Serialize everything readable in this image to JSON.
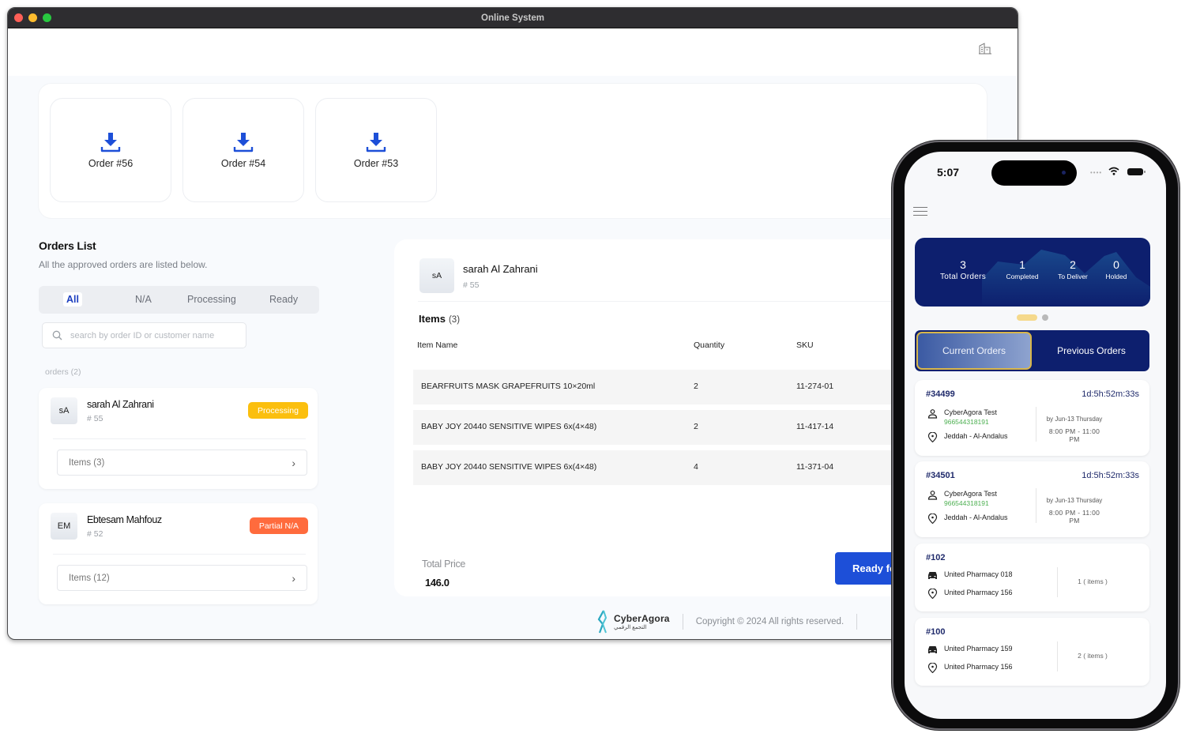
{
  "window": {
    "title": "Online System"
  },
  "downloads": [
    {
      "label": "Order #56",
      "icon": "download-icon"
    },
    {
      "label": "Order #54",
      "icon": "download-icon"
    },
    {
      "label": "Order #53",
      "icon": "download-icon"
    }
  ],
  "orders_list": {
    "title": "Orders List",
    "subtitle": "All the approved orders are listed below.",
    "tabs": [
      "All",
      "N/A",
      "Processing",
      "Ready"
    ],
    "active_tab": "All",
    "search_placeholder": "search by order ID or customer name",
    "count_label": "orders (2)",
    "orders": [
      {
        "initials": "sA",
        "name": "sarah Al Zahrani",
        "id": "# 55",
        "status": "Processing",
        "status_color": "#fbbf0e",
        "items_label": "Items  (3)"
      },
      {
        "initials": "EM",
        "name": "Ebtesam Mahfouz",
        "id": "# 52",
        "status": "Partial N/A",
        "status_color": "#ff6b3d",
        "items_label": "Items  (12)"
      }
    ]
  },
  "detail": {
    "initials": "sA",
    "name": "sarah Al Zahrani",
    "id": "# 55",
    "items_title": "Items",
    "items_count": "(3)",
    "columns": [
      "Item Name",
      "Quantity",
      "SKU"
    ],
    "rows": [
      {
        "name": "BEARFRUITS MASK GRAPEFRUITS 10×20ml",
        "qty": "2",
        "sku": "11-274-01"
      },
      {
        "name": "BABY JOY 20440 SENSITIVE WIPES 6x(4×48)",
        "qty": "2",
        "sku": "11-417-14"
      },
      {
        "name": "BABY JOY 20440 SENSITIVE WIPES 6x(4×48)",
        "qty": "4",
        "sku": "11-371-04"
      }
    ],
    "total_label": "Total Price",
    "total_value": "146.0",
    "ready_button": "Ready for Pickup"
  },
  "footer": {
    "brand": "CyberAgora",
    "brand_ar": "التجمع الرقمي",
    "copyright": "Copyright © 2024 All rights reserved."
  },
  "phone": {
    "time": "5:07",
    "stats": [
      {
        "value": "3",
        "label": "Total Orders"
      },
      {
        "value": "1",
        "label": "Completed"
      },
      {
        "value": "2",
        "label": "To Deliver"
      },
      {
        "value": "0",
        "label": "Holded"
      }
    ],
    "segments": [
      "Current Orders",
      "Previous Orders"
    ],
    "active_segment": "Current Orders",
    "current_orders": [
      {
        "id": "#34499",
        "timer": "1d:5h:52m:33s",
        "customer": "CyberAgora Test",
        "phone": "966544318191",
        "location": "Jeddah - Al-Andalus",
        "date": "by Jun-13 Thursday",
        "time_window": "8:00 PM - 11:00 PM"
      },
      {
        "id": "#34501",
        "timer": "1d:5h:52m:33s",
        "customer": "CyberAgora Test",
        "phone": "966544318191",
        "location": "Jeddah - Al-Andalus",
        "date": "by Jun-13 Thursday",
        "time_window": "8:00 PM - 11:00 PM"
      }
    ],
    "transfer_orders": [
      {
        "id": "#102",
        "from": "United Pharmacy 018",
        "to": "United Pharmacy 156",
        "items": "1  ( items )"
      },
      {
        "id": "#100",
        "from": "United Pharmacy 159",
        "to": "United Pharmacy 156",
        "items": "2  ( items )"
      }
    ]
  }
}
